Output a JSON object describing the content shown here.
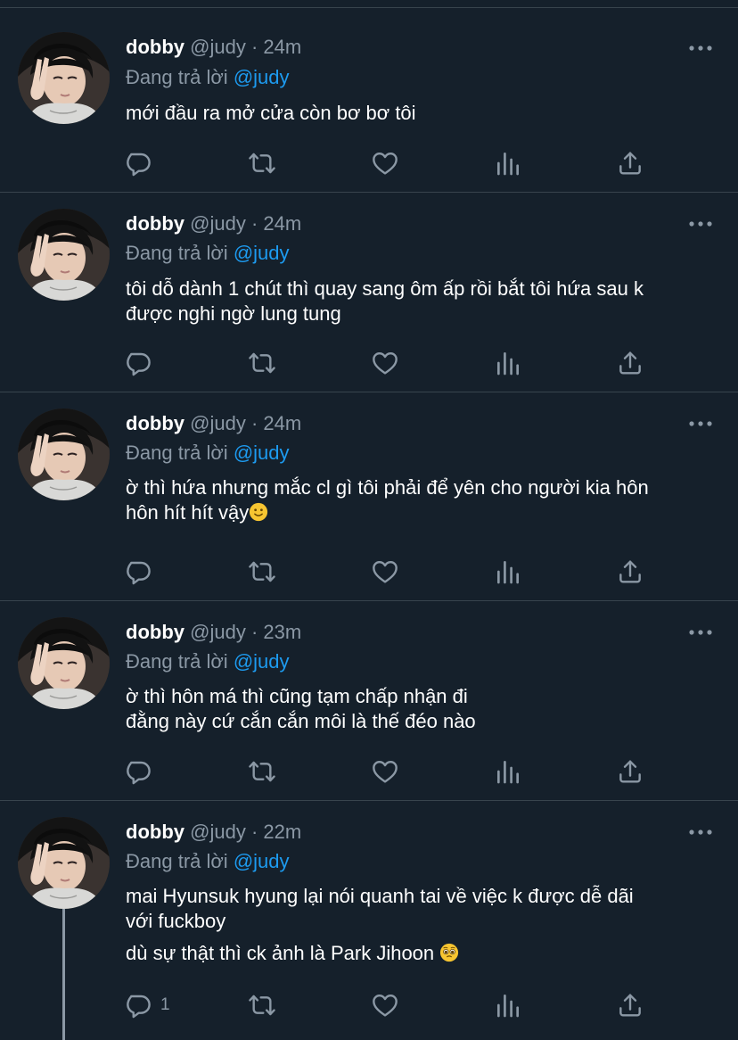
{
  "tweets": [
    {
      "name": "dobby",
      "handle": "@judy",
      "sep": "·",
      "time": "24m",
      "replying_prefix": "Đang trả lời",
      "replying_to": "@judy",
      "lines": [
        "mới đầu ra mở cửa còn bơ bơ tôi"
      ],
      "reply_count": ""
    },
    {
      "name": "dobby",
      "handle": "@judy",
      "sep": "·",
      "time": "24m",
      "replying_prefix": "Đang trả lời",
      "replying_to": "@judy",
      "lines": [
        "tôi dỗ dành 1 chút thì quay sang ôm ấp rồi bắt tôi hứa sau k",
        "được nghi ngờ lung tung"
      ],
      "reply_count": ""
    },
    {
      "name": "dobby",
      "handle": "@judy",
      "sep": "·",
      "time": "24m",
      "replying_prefix": "Đang trả lời",
      "replying_to": "@judy",
      "lines": [
        "ờ thì hứa nhưng mắc cl gì tôi phải để yên cho người kia hôn",
        "hôn hít hít vậy"
      ],
      "emoji": "slightly-smiling-face",
      "reply_count": ""
    },
    {
      "name": "dobby",
      "handle": "@judy",
      "sep": "·",
      "time": "23m",
      "replying_prefix": "Đang trả lời",
      "replying_to": "@judy",
      "lines": [
        "ờ thì hôn má thì cũng tạm chấp nhận đi",
        "đằng này cứ cắn cắn môi là thế đéo nào"
      ],
      "reply_count": ""
    },
    {
      "name": "dobby",
      "handle": "@judy",
      "sep": "·",
      "time": "22m",
      "replying_prefix": "Đang trả lời",
      "replying_to": "@judy",
      "lines": [
        "mai Hyunsuk hyung lại nói quanh tai về việc k được dễ dãi",
        "với fuckboy",
        "dù sự thật thì ck ảnh là Park Jihoon"
      ],
      "emoji": "pleading-face",
      "reply_count": "1"
    }
  ],
  "icons": {
    "reply": "reply-icon",
    "retweet": "retweet-icon",
    "like": "like-icon",
    "views": "analytics-icon",
    "share": "share-icon",
    "more": "more-icon"
  },
  "colors": {
    "background": "#15202b",
    "text": "#ffffff",
    "muted": "#8b98a5",
    "accent": "#1d9bf0",
    "divider": "#38444d"
  }
}
